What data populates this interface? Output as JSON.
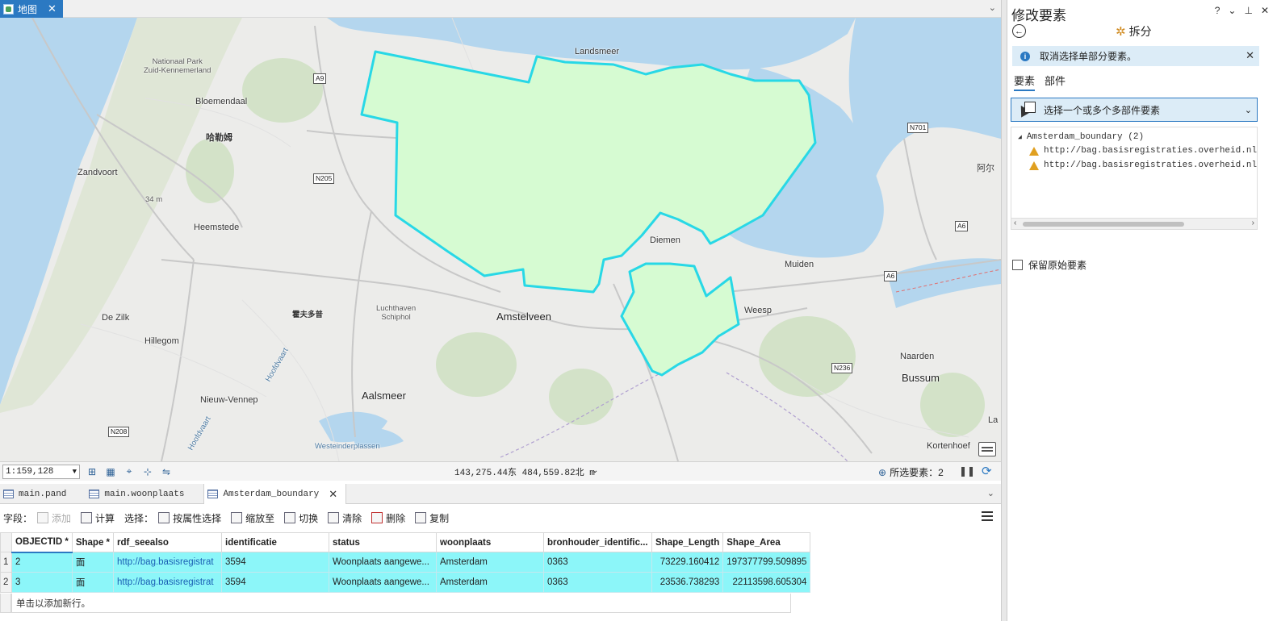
{
  "map_tab": {
    "label": "地图"
  },
  "map": {
    "places": {
      "landsmeer": "Landsmeer",
      "national_park": "Nationaal Park\nZuid-Kennemerland",
      "bloemendaal": "Bloemendaal",
      "haarlem": "哈勒姆",
      "zandvoort": "Zandvoort",
      "elevation": "34 m",
      "heemstede": "Heemstede",
      "de_zilk": "De Zilk",
      "hillegom": "Hillegom",
      "hoofdvaart": "Hoofdvaart",
      "hoofdvaart2": "Hoofdvaart",
      "nieuw_vennep": "Nieuw-Vennep",
      "haarlemmermeer": "霍夫多普",
      "schiphol": "Luchthaven\nSchiphol",
      "amstelveen": "Amstelveen",
      "aalsmeer": "Aalsmeer",
      "westeinderplassen": "Westeinderplassen",
      "diemen": "Diemen",
      "muiden": "Muiden",
      "weesp": "Weesp",
      "naarden": "Naarden",
      "bussum": "Bussum",
      "kortenhoef": "Kortenhoef",
      "almere": "阿尔",
      "laren": "La"
    },
    "roads": {
      "a9": "A9",
      "n205": "N205",
      "n208": "N208",
      "n701": "N701",
      "a6": "A6",
      "a6b": "A6",
      "n236": "N236"
    }
  },
  "status_bar": {
    "scale": "1:159,128",
    "coordinates": "143,275.44东 484,559.82北 m",
    "selected_label": "所选要素：2"
  },
  "attr_tabs": [
    {
      "label": "main.pand"
    },
    {
      "label": "main.woonplaats"
    },
    {
      "label": "Amsterdam_boundary"
    }
  ],
  "attr_toolbar": {
    "field_label": "字段：",
    "add": "添加",
    "calculate": "计算",
    "select_label": "选择：",
    "select_by_attr": "按属性选择",
    "zoom_to": "缩放至",
    "switch": "切换",
    "clear": "清除",
    "delete": "删除",
    "copy": "复制"
  },
  "table": {
    "columns": [
      "OBJECTID *",
      "Shape *",
      "rdf_seealso",
      "identificatie",
      "status",
      "woonplaats",
      "bronhouder_identific...",
      "Shape_Length",
      "Shape_Area"
    ],
    "rows": [
      {
        "num": "1",
        "cells": [
          "2",
          "面",
          "http://bag.basisregistrat",
          "3594",
          "Woonplaats aangewe...",
          "Amsterdam",
          "0363",
          "73229.160412",
          "197377799.509895"
        ]
      },
      {
        "num": "2",
        "cells": [
          "3",
          "面",
          "http://bag.basisregistrat",
          "3594",
          "Woonplaats aangewe...",
          "Amsterdam",
          "0363",
          "23536.738293",
          "22113598.605304"
        ]
      }
    ],
    "add_row_hint": "单击以添加新行。"
  },
  "panel": {
    "title": "修改要素",
    "controls": [
      "?",
      "⌄",
      "⊥",
      "✕"
    ],
    "tool_name": "拆分",
    "info_message": "取消选择单部分要素。",
    "tabs": [
      "要素",
      "部件"
    ],
    "select_tool_label": "选择一个或多个多部件要素",
    "tree": {
      "layer": "Amsterdam_boundary (2)",
      "items": [
        "http://bag.basisregistraties.overheid.nl/bag/",
        "http://bag.basisregistraties.overheid.nl/bag/"
      ]
    },
    "keep_original": "保留原始要素"
  },
  "colors": {
    "accent": "#2b79c2",
    "selection": "#8cf6f9",
    "polygon_fill": "#d6fbd2",
    "polygon_stroke": "#28d8e6"
  }
}
